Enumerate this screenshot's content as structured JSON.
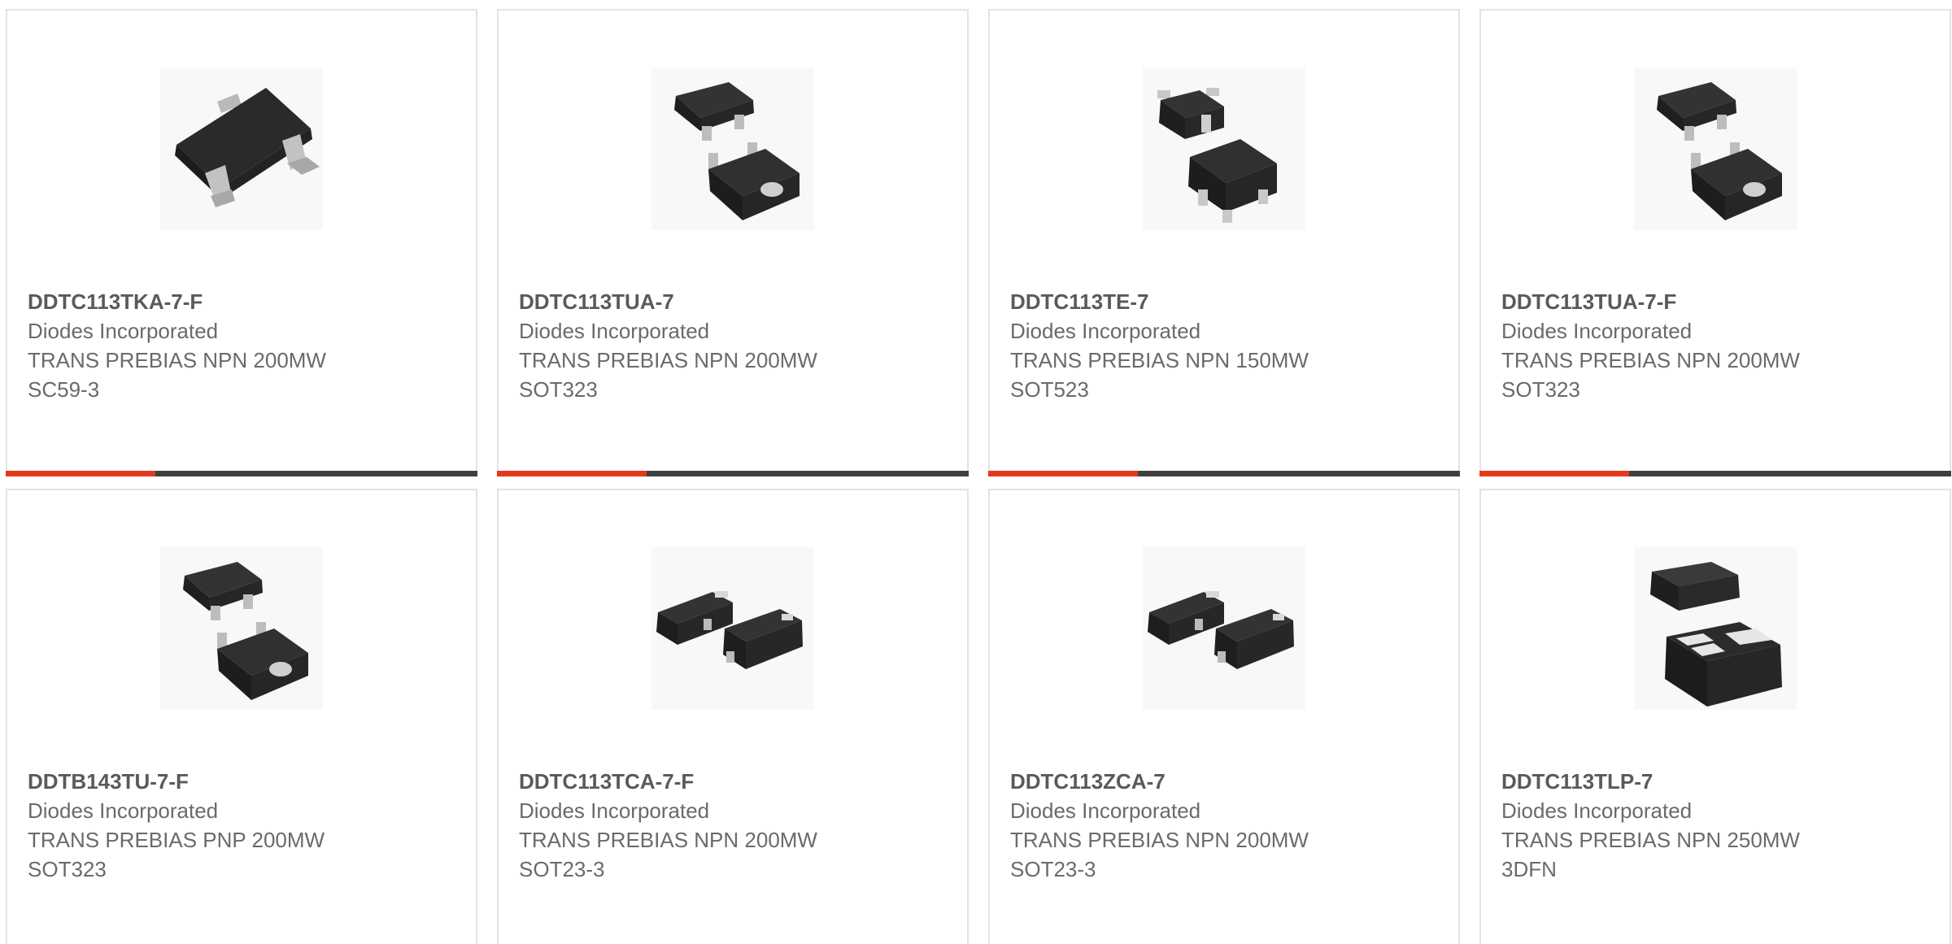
{
  "colors": {
    "accent": "#e23b1c",
    "bar_dark": "#3f3f3f",
    "card_border": "#e3e3e3"
  },
  "products": [
    {
      "part_number": "DDTC113TKA-7-F",
      "manufacturer": "Diodes Incorporated",
      "description": "TRANS PREBIAS NPN 200MW",
      "package": "SC59-3",
      "image_icon": "sot-package-single-icon"
    },
    {
      "part_number": "DDTC113TUA-7",
      "manufacturer": "Diodes Incorporated",
      "description": "TRANS PREBIAS NPN 200MW",
      "package": "SOT323",
      "image_icon": "sot-package-pair-icon"
    },
    {
      "part_number": "DDTC113TE-7",
      "manufacturer": "Diodes Incorporated",
      "description": "TRANS PREBIAS NPN 150MW",
      "package": "SOT523",
      "image_icon": "sot-package-pair-icon"
    },
    {
      "part_number": "DDTC113TUA-7-F",
      "manufacturer": "Diodes Incorporated",
      "description": "TRANS PREBIAS NPN 200MW",
      "package": "SOT323",
      "image_icon": "sot-package-pair-icon"
    },
    {
      "part_number": "DDTB143TU-7-F",
      "manufacturer": "Diodes Incorporated",
      "description": "TRANS PREBIAS PNP 200MW",
      "package": "SOT323",
      "image_icon": "sot-package-pair-icon"
    },
    {
      "part_number": "DDTC113TCA-7-F",
      "manufacturer": "Diodes Incorporated",
      "description": "TRANS PREBIAS NPN 200MW",
      "package": "SOT23-3",
      "image_icon": "sot-package-side-pair-icon"
    },
    {
      "part_number": "DDTC113ZCA-7",
      "manufacturer": "Diodes Incorporated",
      "description": "TRANS PREBIAS NPN 200MW",
      "package": "SOT23-3",
      "image_icon": "sot-package-side-pair-icon"
    },
    {
      "part_number": "DDTC113TLP-7",
      "manufacturer": "Diodes Incorporated",
      "description": "TRANS PREBIAS NPN 250MW",
      "package": "3DFN",
      "image_icon": "dfn-package-icon"
    }
  ]
}
